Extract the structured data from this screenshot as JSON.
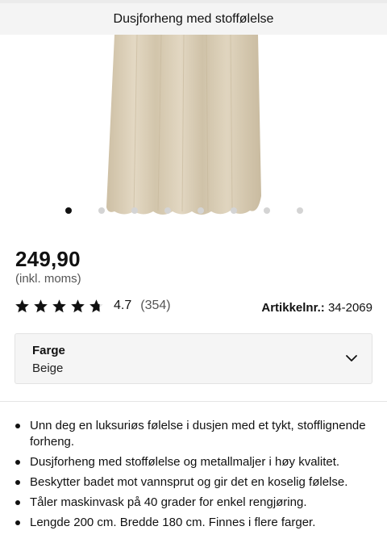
{
  "header": {
    "title": "Dusjforheng med stoffølelse"
  },
  "gallery": {
    "image_count": 8,
    "active_index": 0
  },
  "product": {
    "price": "249,90",
    "vat_note": "(inkl. moms)",
    "rating": {
      "stars": 4.7,
      "value": "4.7",
      "count": "(354)"
    },
    "sku_label": "Artikkelnr.:",
    "sku_value": "34-2069"
  },
  "color_select": {
    "label": "Farge",
    "value": "Beige"
  },
  "bullets": [
    "Unn deg en luksuriøs følelse i dusjen med et tykt, stofflignende forheng.",
    "Dusjforheng med stoffølelse og metallmaljer i høy kvalitet.",
    "Beskytter badet mot vannsprut og gir det en koselig følelse.",
    "Tåler maskinvask på 40 grader for enkel rengjøring.",
    "Lengde 200 cm. Bredde 180 cm. Finnes i flere farger."
  ],
  "colors": {
    "curtain": "#d8cdb6",
    "star": "#111111",
    "active_dot": "#111111",
    "inactive_dot": "#d4d4d4"
  }
}
